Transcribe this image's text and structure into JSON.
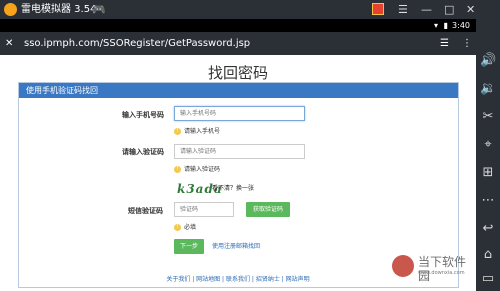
{
  "titlebar": {
    "title": "雷电模拟器 3.54"
  },
  "statusbar": {
    "time": "3:40"
  },
  "urlbar": {
    "close_symbol": "✕",
    "url": "sso.ipmph.com/SSORegister/GetPassword.jsp"
  },
  "page": {
    "title": "找回密码",
    "panel_header": "使用手机验证码找回",
    "phone_label": "输入手机号码",
    "phone_placeholder": "输入手机号码",
    "phone_hint": "请输入手机号",
    "captcha_label": "请输入验证码",
    "captcha_placeholder": "请输入验证码",
    "captcha_hint": "请输入验证码",
    "captcha_image_text": "k3ada",
    "captcha_refresh": "看不清？换一张",
    "sms_label": "短信验证码",
    "sms_placeholder": "验证码",
    "get_code_button": "获取验证码",
    "sms_hint": "必填",
    "next_button": "下一步",
    "email_link": "使用注册邮箱找回",
    "footer_links": "关于我们 | 网站地图 | 联系我们 | 招贤纳士 | 网站声明"
  },
  "watermark": {
    "text": "当下软件园",
    "url": "www.downxia.com"
  },
  "icons": {
    "app": "emulator-logo",
    "gamepad": "gamepad-icon",
    "gift": "gift-icon",
    "menu": "menu-icon",
    "minimize": "minimize-icon",
    "maximize": "maximize-icon",
    "close": "close-icon"
  },
  "sidebar": [
    "volume-up-icon",
    "volume-down-icon",
    "scissors-icon",
    "location-icon",
    "add-icon",
    "more-icon",
    "back-icon",
    "home-icon",
    "apps-icon"
  ]
}
